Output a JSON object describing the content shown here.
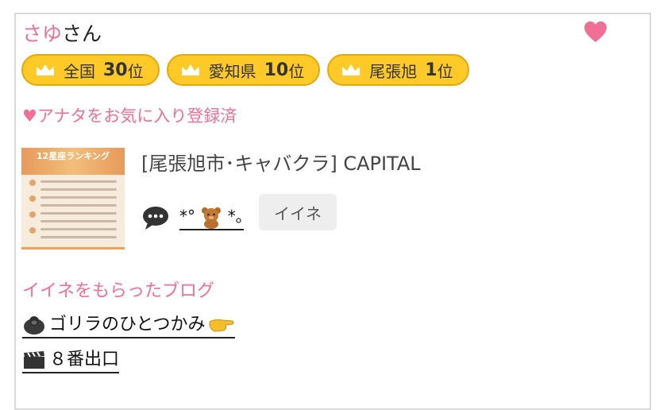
{
  "user": {
    "nickname": "さゆ",
    "honorific": "さん"
  },
  "icons": {
    "favorite": "heart-icon",
    "crown": "crown-icon",
    "comment": "speech-bubble-icon",
    "bear": "bear-emoji",
    "gorilla": "gorilla-emoji",
    "clapper": "clapper-board-emoji",
    "hand": "pointing-hand-emoji"
  },
  "badges": [
    {
      "area": "全国",
      "rank": "30",
      "suffix": "位"
    },
    {
      "area": "愛知県",
      "rank": "10",
      "suffix": "位"
    },
    {
      "area": "尾張旭",
      "rank": "1",
      "suffix": "位"
    }
  ],
  "favorite_status": "♥アナタをお気に入り登録済",
  "post": {
    "thumbnail_title": "12星座ランキング",
    "venue": "[尾張旭市･キャバクラ]  CAPITAL",
    "reaction_text_left": "*°",
    "reaction_text_right": "*｡",
    "like_label": "イイネ"
  },
  "liked_blogs": {
    "title": "イイネをもらったブログ",
    "items": [
      {
        "label": "ゴリラのひとつかみ"
      },
      {
        "label": "８番出口"
      }
    ]
  },
  "colors": {
    "accent_pink": "#f06f95",
    "badge_gold": "#ffc928"
  }
}
